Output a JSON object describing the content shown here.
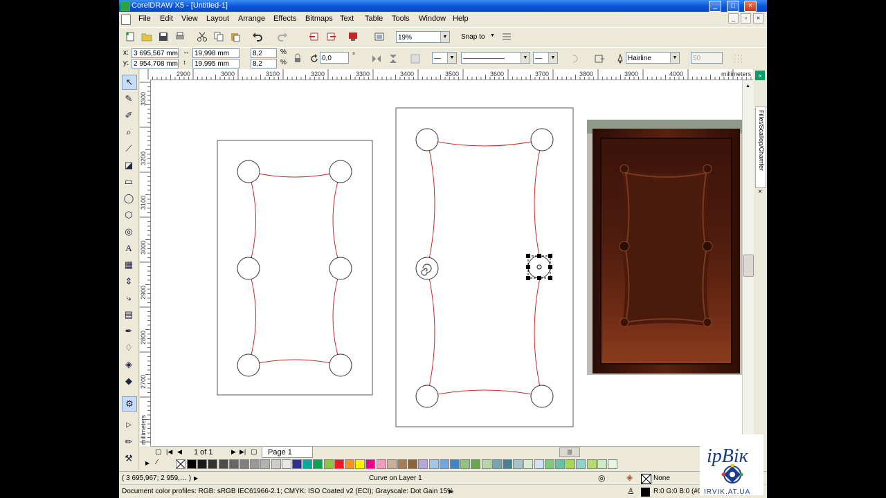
{
  "window": {
    "title": "CorelDRAW X5 - [Untitled-1]",
    "controls": [
      "_",
      "□",
      "×"
    ]
  },
  "menu": [
    "File",
    "Edit",
    "View",
    "Layout",
    "Arrange",
    "Effects",
    "Bitmaps",
    "Text",
    "Table",
    "Tools",
    "Window",
    "Help"
  ],
  "toolbar": {
    "zoom": "19%",
    "snap_label": "Snap to"
  },
  "property_bar": {
    "x_label": "x:",
    "y_label": "y:",
    "x": "3 695,567 mm",
    "y": "2 954,708 mm",
    "width": "19,998 mm",
    "height": "19,995 mm",
    "scale_w": "8,2",
    "scale_h": "8,2",
    "percent": "%",
    "angle": "0,0",
    "degree": "°",
    "outline": "Hairline",
    "fillet": "50"
  },
  "ruler_h": {
    "unit": "millimeters",
    "ticks": [
      "2900",
      "3000",
      "3100",
      "3200",
      "3300",
      "3400",
      "3500",
      "3600",
      "3700",
      "3800",
      "3900",
      "4000"
    ]
  },
  "ruler_v": {
    "unit": "millimeters",
    "ticks": [
      "3300",
      "3200",
      "3100",
      "3000",
      "2900",
      "2800",
      "2700"
    ]
  },
  "docker_label": "Fillet/Scallop/Chamfer",
  "page_nav": {
    "count": "1 of 1",
    "tab": "Page 1"
  },
  "palette": [
    "#ffffff",
    "#000000",
    "#1a1a1a",
    "#333333",
    "#4d4d4d",
    "#666666",
    "#808080",
    "#999999",
    "#b3b3b3",
    "#cccccc",
    "#e6e6e6",
    "#2e3192",
    "#00a99d",
    "#00a651",
    "#8dc63f",
    "#ed1c24",
    "#f7941d",
    "#fff200",
    "#ec008c",
    "#f49ac1",
    "#c7b299",
    "#a67c52",
    "#8c6239",
    "#b4a7d6",
    "#9fc5e8",
    "#6fa8dc",
    "#3d85c6",
    "#93c47d",
    "#6aa84f",
    "#b6d7a8",
    "#76a5af",
    "#45818e",
    "#a2c4c9",
    "#d9ead3",
    "#cfe2f3",
    "#7fc97f",
    "#66c2a5",
    "#a6d854",
    "#8dd3c7",
    "#b3de69",
    "#ccebc5",
    "#e5f5e0"
  ],
  "status": {
    "coords": "( 3 695,967; 2 959,… )",
    "selection": "Curve on Layer 1",
    "fill": "None",
    "color_profiles": "Document color profiles: RGB: sRGB IEC61966-2.1; CMYK: ISO Coated v2 (ECI); Grayscale: Dot Gain 15%",
    "outline_color": "R:0 G:0 B:0 (#0"
  },
  "watermark": {
    "name": "ірВік",
    "site": "IRVIK.AT.UA"
  },
  "colors": {
    "title_bar": "#0a54d8",
    "curve": "#cc2a2a",
    "chrome": "#ece9d8",
    "wood_dark": "#3a130a",
    "wood_mid": "#6b2a14"
  }
}
